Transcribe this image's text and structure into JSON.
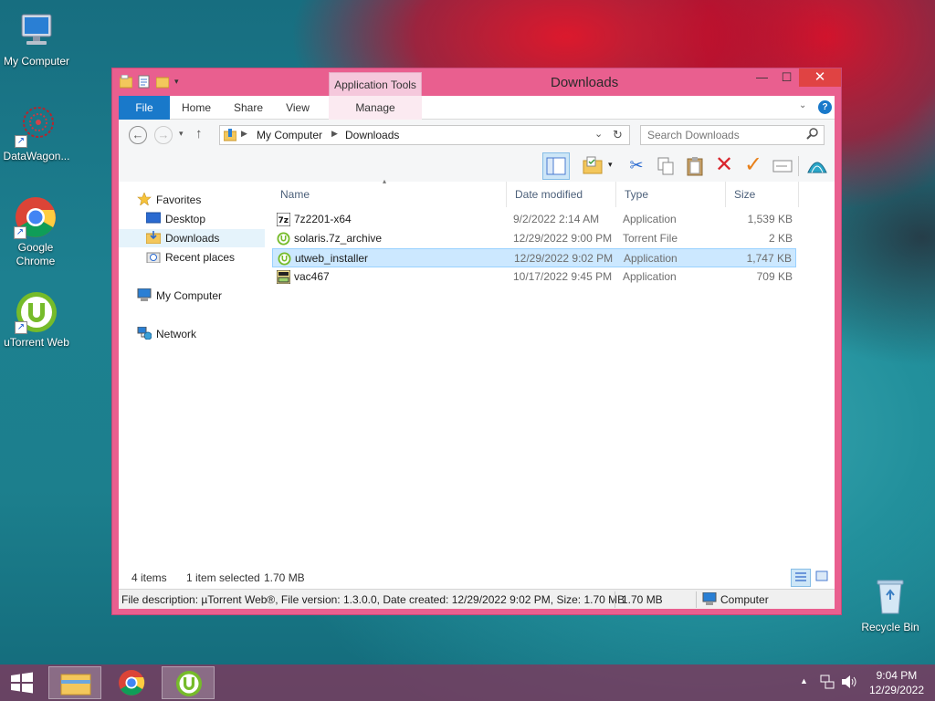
{
  "desktop": {
    "icons": [
      {
        "label": "My Computer"
      },
      {
        "label": "DataWagon..."
      },
      {
        "label": "Google Chrome"
      },
      {
        "label": "uTorrent Web"
      },
      {
        "label": "Recycle Bin"
      }
    ]
  },
  "window": {
    "title": "Downloads",
    "contextual_tab_group": "Application Tools",
    "ribbon_tabs": [
      "File",
      "Home",
      "Share",
      "View",
      "Manage"
    ],
    "controls": {
      "minimize": "—",
      "maximize": "☐",
      "close": "✕"
    }
  },
  "address": {
    "breadcrumb": [
      "My Computer",
      "Downloads"
    ],
    "search_placeholder": "Search Downloads"
  },
  "navpane": {
    "favorites": "Favorites",
    "items": [
      "Desktop",
      "Downloads",
      "Recent places"
    ],
    "my_computer": "My Computer",
    "network": "Network",
    "selected": "Downloads"
  },
  "columns": [
    "Name",
    "Date modified",
    "Type",
    "Size"
  ],
  "files": [
    {
      "name": "7z2201-x64",
      "date": "9/2/2022 2:14 AM",
      "type": "Application",
      "size": "1,539 KB",
      "icon": "7zip-icon"
    },
    {
      "name": "solaris.7z_archive",
      "date": "12/29/2022 9:00 PM",
      "type": "Torrent File",
      "size": "2 KB",
      "icon": "utorrent-icon"
    },
    {
      "name": "utweb_installer",
      "date": "12/29/2022 9:02 PM",
      "type": "Application",
      "size": "1,747 KB",
      "icon": "utorrent-icon",
      "selected": true
    },
    {
      "name": "vac467",
      "date": "10/17/2022 9:45 PM",
      "type": "Application",
      "size": "709 KB",
      "icon": "installer-icon"
    }
  ],
  "status": {
    "count": "4 items",
    "selection": "1 item selected",
    "selection_size": "1.70 MB"
  },
  "details": {
    "description": "File description: µTorrent Web®, File version: 1.3.0.0, Date created: 12/29/2022 9:02 PM, Size: 1.70 MB",
    "size": "1.70 MB",
    "location": "Computer"
  },
  "taskbar": {
    "time": "9:04 PM",
    "date": "12/29/2022"
  },
  "colors": {
    "window_frame": "#e95f8f",
    "file_tab": "#1979ca",
    "selection": "#cce8ff",
    "close_button": "#e04343"
  }
}
